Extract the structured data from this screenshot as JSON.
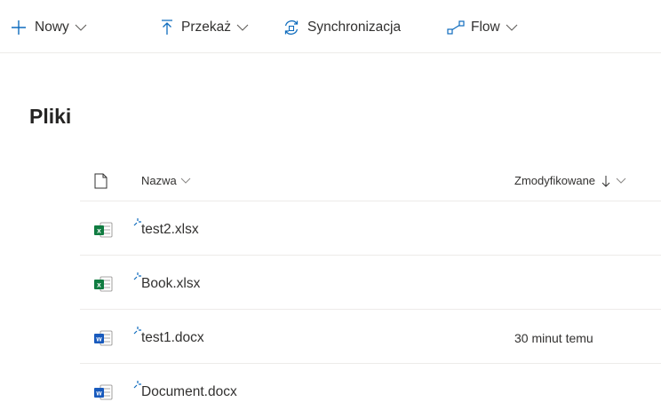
{
  "command_bar": {
    "new_label": "Nowy",
    "upload_label": "Przekaż",
    "sync_label": "Synchronizacja",
    "flow_label": "Flow"
  },
  "page": {
    "title": "Pliki"
  },
  "list": {
    "columns": {
      "name": "Nazwa",
      "modified": "Zmodyfikowane"
    },
    "sort": {
      "column": "modified",
      "direction": "descending"
    },
    "rows": [
      {
        "name": "test2.xlsx",
        "type": "excel-icon",
        "modified": ""
      },
      {
        "name": "Book.xlsx",
        "type": "excel-icon",
        "modified": ""
      },
      {
        "name": "test1.docx",
        "type": "word-icon",
        "modified": "30 minut temu"
      },
      {
        "name": "Document.docx",
        "type": "word-icon",
        "modified": ""
      }
    ]
  },
  "colors": {
    "accent": "#0f6cbd",
    "excel": "#107c41",
    "word": "#185abd",
    "divider": "#edebe9",
    "text": "#323130"
  }
}
